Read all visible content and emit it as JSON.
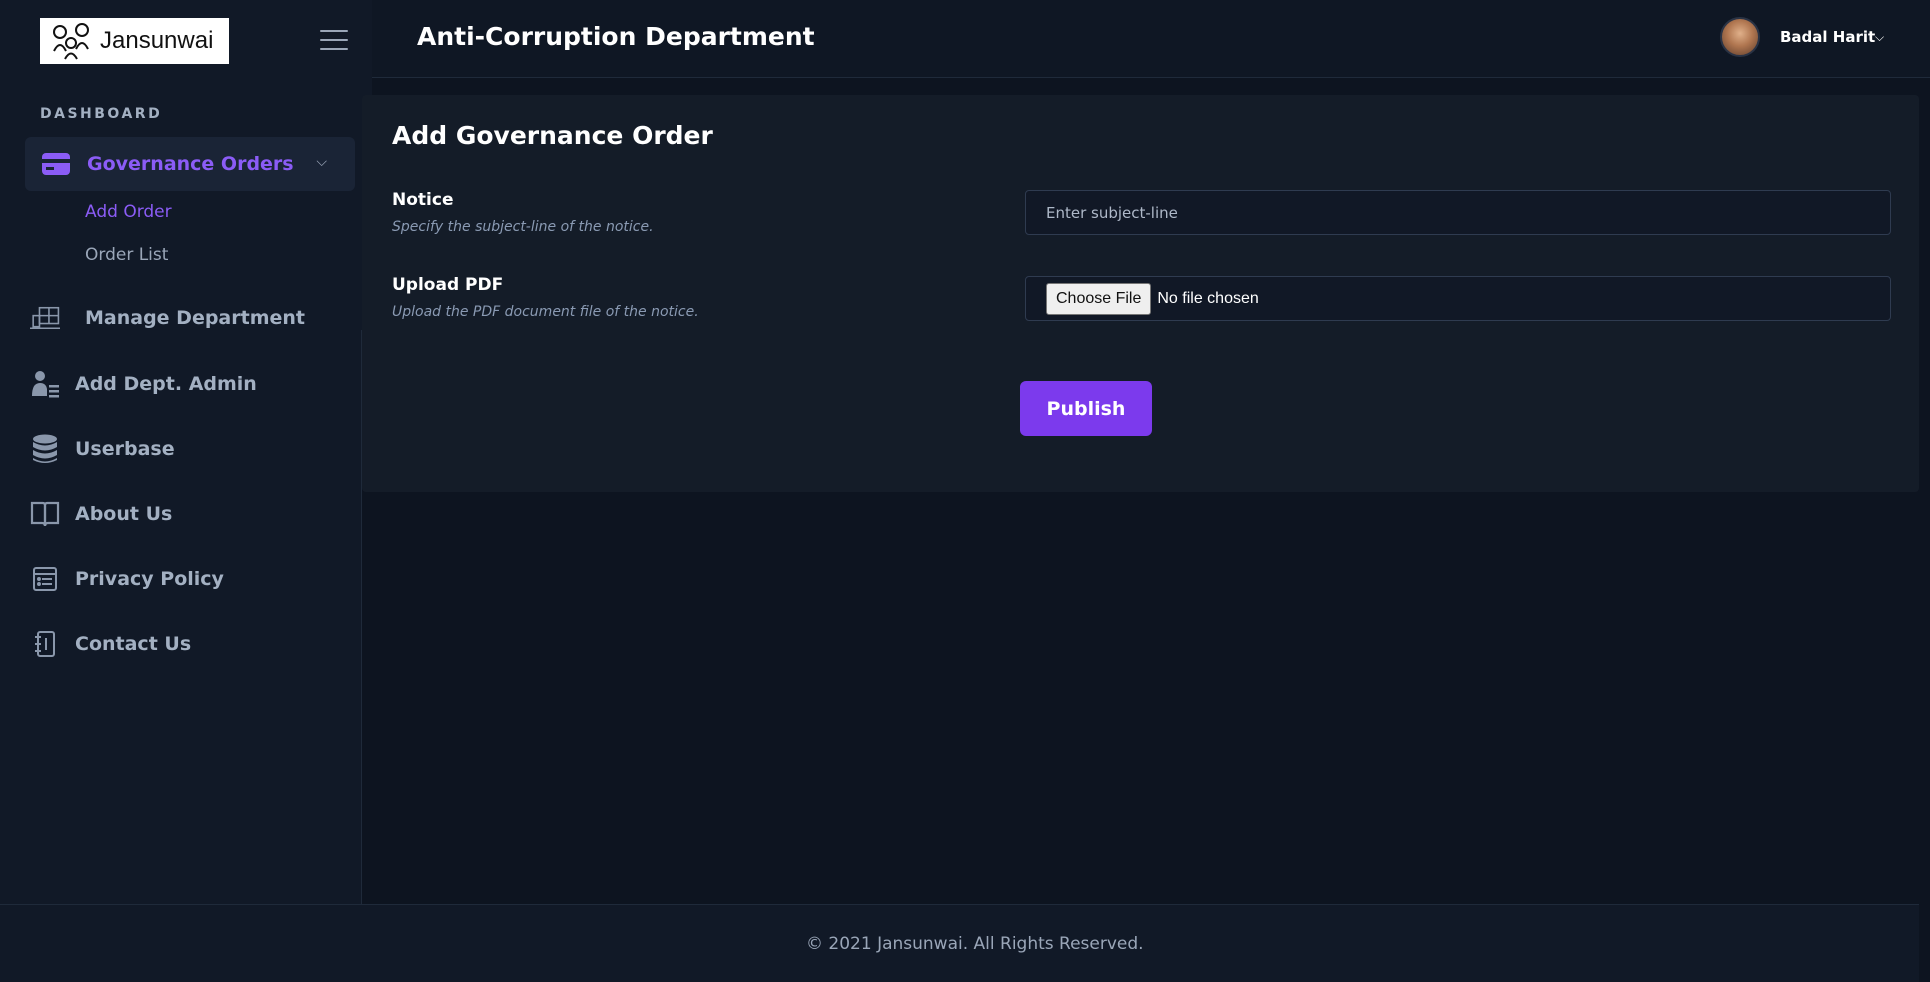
{
  "brand": {
    "name": "Jansunwai"
  },
  "sidebar": {
    "section_label": "DASHBOARD",
    "active_group": {
      "label": "Governance Orders",
      "icon": "credit-card-icon"
    },
    "sub_items": [
      {
        "label": "Add Order",
        "active": true
      },
      {
        "label": "Order List",
        "active": false
      }
    ],
    "items": [
      {
        "label": "Manage Department",
        "icon": "building-icon"
      },
      {
        "label": "Add Dept. Admin",
        "icon": "user-admin-icon"
      },
      {
        "label": "Userbase",
        "icon": "database-icon"
      },
      {
        "label": "About Us",
        "icon": "book-icon"
      },
      {
        "label": "Privacy Policy",
        "icon": "document-list-icon"
      },
      {
        "label": "Contact Us",
        "icon": "contact-book-icon"
      }
    ]
  },
  "header": {
    "title": "Anti-Corruption Department",
    "user_name": "Badal Harit"
  },
  "form": {
    "title": "Add Governance Order",
    "notice": {
      "label": "Notice",
      "help": "Specify the subject-line of the notice.",
      "placeholder": "Enter subject-line",
      "value": ""
    },
    "upload": {
      "label": "Upload PDF",
      "help": "Upload the PDF document file of the notice.",
      "button_label": "Choose File",
      "status": "No file chosen"
    },
    "submit_label": "Publish"
  },
  "footer": {
    "text": "© 2021 Jansunwai. All Rights Reserved."
  },
  "colors": {
    "accent": "#8b5cf6",
    "button": "#7c3aed",
    "background": "#0d1420",
    "panel": "#141c28"
  }
}
